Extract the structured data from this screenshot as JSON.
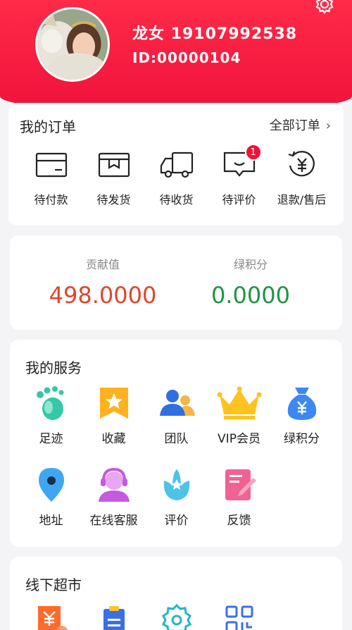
{
  "profile": {
    "name": "龙女",
    "phone": "19107992538",
    "id_text": "ID:00000104"
  },
  "orders": {
    "title": "我的订单",
    "all_label": "全部订单",
    "items": [
      {
        "label": "待付款",
        "icon": "wallet-icon"
      },
      {
        "label": "待发货",
        "icon": "package-icon"
      },
      {
        "label": "待收货",
        "icon": "truck-icon"
      },
      {
        "label": "待评价",
        "icon": "comment-icon",
        "badge": "1"
      },
      {
        "label": "退款/售后",
        "icon": "refund-icon"
      }
    ]
  },
  "stats": {
    "contribution_label": "贡献值",
    "contribution_value": "498.0000",
    "green_points_label": "绿积分",
    "green_points_value": "0.0000"
  },
  "services": {
    "title": "我的服务",
    "items": [
      {
        "label": "足迹",
        "icon": "footprint-icon"
      },
      {
        "label": "收藏",
        "icon": "favorite-star-icon"
      },
      {
        "label": "团队",
        "icon": "team-icon"
      },
      {
        "label": "VIP会员",
        "icon": "crown-icon"
      },
      {
        "label": "绿积分",
        "icon": "money-bag-icon"
      },
      {
        "label": "地址",
        "icon": "location-pin-icon"
      },
      {
        "label": "在线客服",
        "icon": "customer-service-icon"
      },
      {
        "label": "评价",
        "icon": "review-flower-icon"
      },
      {
        "label": "反馈",
        "icon": "feedback-edit-icon"
      }
    ]
  },
  "offline": {
    "title": "线下超市"
  },
  "colors": {
    "brand_red": "#f0123a",
    "contribution": "#e0462b",
    "green_points": "#1f9446"
  }
}
